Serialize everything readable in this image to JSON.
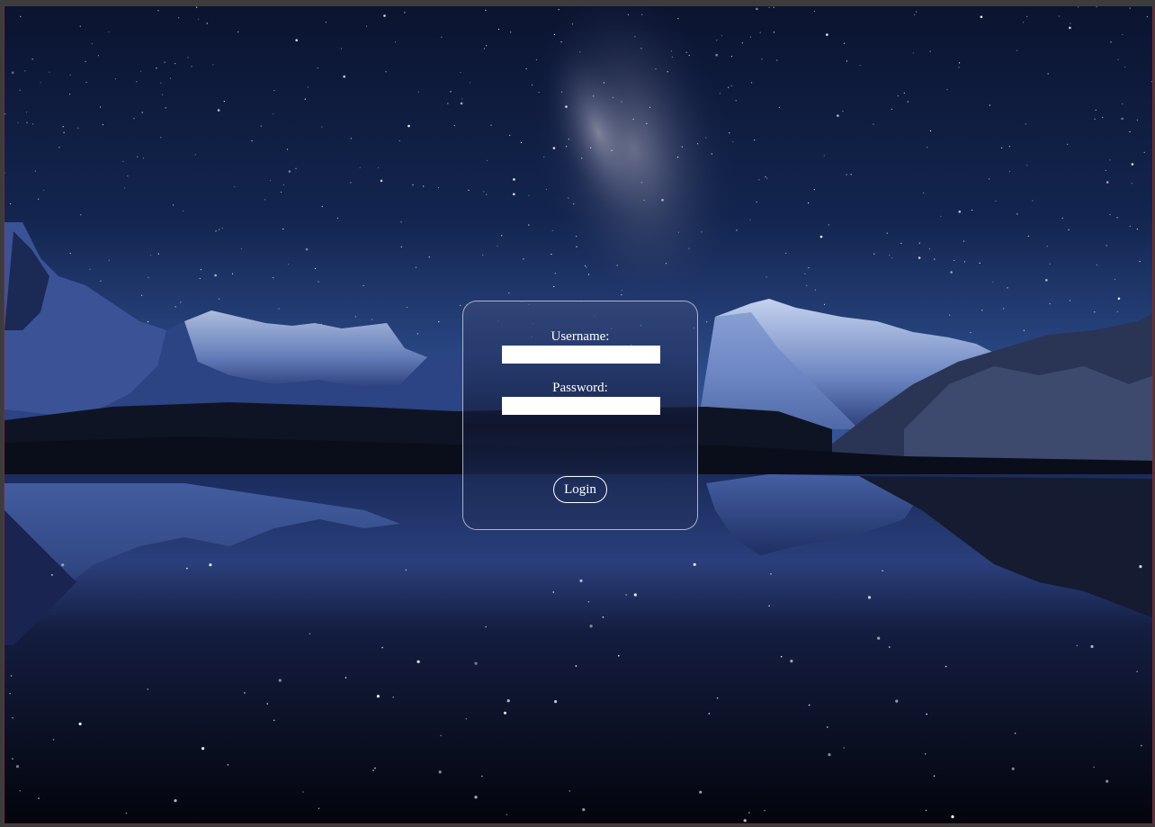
{
  "login_form": {
    "username_label": "Username:",
    "username_value": "",
    "password_label": "Password:",
    "password_value": "",
    "login_button_label": "Login"
  },
  "colors": {
    "sky_top": "#0a1530",
    "sky_horizon": "#2a4a8a",
    "mountain_snow": "#9fb3dc",
    "mountain_shadow": "#1b2a55",
    "water_dark": "#04060f",
    "card_border": "#dce1f0",
    "frame_border": "#7a2a3a"
  }
}
